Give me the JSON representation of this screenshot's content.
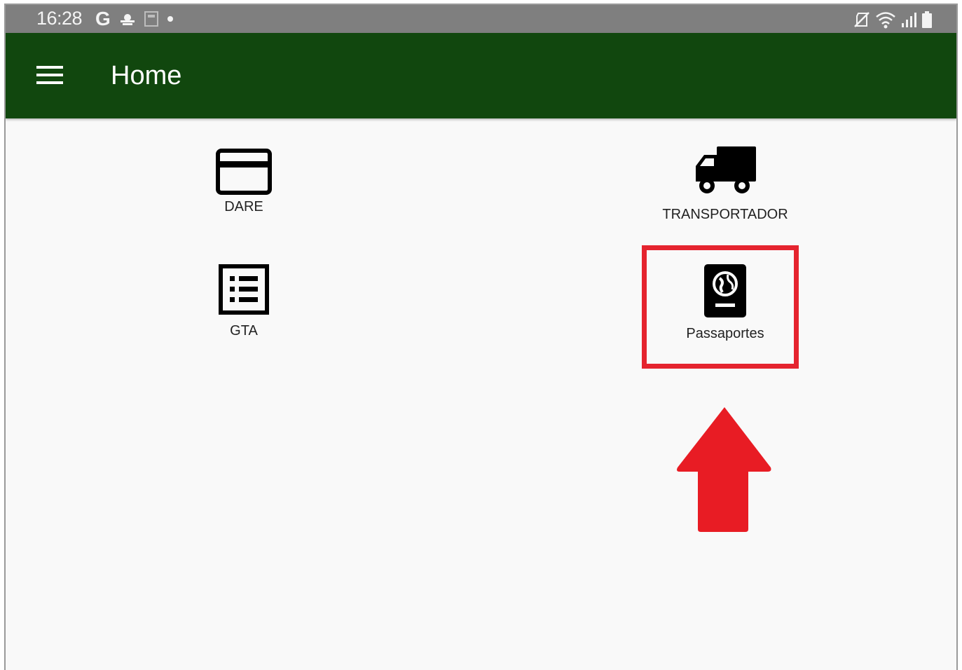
{
  "status_bar": {
    "time": "16:28",
    "left_icons": [
      "google-g-icon",
      "weather-icon",
      "notification-icon",
      "dot-icon"
    ],
    "right_icons": [
      "no-sim-icon",
      "wifi-icon",
      "signal-icon",
      "battery-icon"
    ],
    "g_label": "G"
  },
  "app_bar": {
    "title": "Home",
    "background_color": "#11470e"
  },
  "tiles": [
    {
      "label": "DARE",
      "icon": "credit-card-icon"
    },
    {
      "label": "TRANSPORTADOR",
      "icon": "truck-icon"
    },
    {
      "label": "GTA",
      "icon": "list-icon"
    },
    {
      "label": "Passaportes",
      "icon": "passport-icon"
    }
  ],
  "annotation": {
    "highlight_color": "#e5242f",
    "arrow_color": "#e81c24"
  }
}
